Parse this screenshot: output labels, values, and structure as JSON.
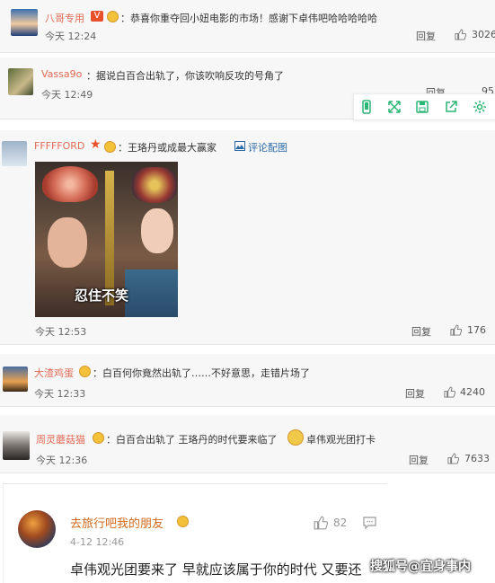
{
  "comments": [
    {
      "username": "八哥专用",
      "text": "：恭喜你重夺回小妞电影的市场！感谢下卓伟吧哈哈哈哈哈",
      "time": "今天 12:24",
      "reply": "回复",
      "likes": "3026"
    },
    {
      "username": "Vassa9o",
      "text": "：据说白百合出轨了，你该吹响反攻的号角了",
      "time": "今天 12:49",
      "reply": "回复",
      "likes": "95"
    },
    {
      "username": "FFFFFORD",
      "text": "：王珞丹或成最大赢家",
      "view_image": "评论配图",
      "time": "今天 12:53",
      "reply": "回复",
      "likes": "176",
      "image_caption": "忍住不笑"
    },
    {
      "username": "大渣鸡蛋",
      "text": "：白百何你竟然出轨了……不好意思，走错片场了",
      "time": "今天 12:33",
      "reply": "回复",
      "likes": "4240"
    },
    {
      "username": "周灵蘑菇猫",
      "text_a": "：白百合出轨了 王珞丹的时代要来临了",
      "text_b": "卓伟观光团打卡",
      "time": "今天 12:36",
      "reply": "回复",
      "likes": "7633"
    }
  ],
  "card": {
    "username": "去旅行吧我的朋友",
    "date": "4-12 12:46",
    "likes": "82",
    "text": "卓伟观光团要来了 早就应该属于你的时代 又要还"
  },
  "watermark": "搜狐号@宜身事内",
  "colors": {
    "username": "#e36a55",
    "vip_badge": "#e8502c",
    "link_blue": "#2b6aa8"
  },
  "icons": [
    "thumb-up-icon",
    "phone-icon",
    "expand-icon",
    "save-icon",
    "share-icon",
    "gear-icon",
    "image-icon",
    "comment-icon"
  ]
}
